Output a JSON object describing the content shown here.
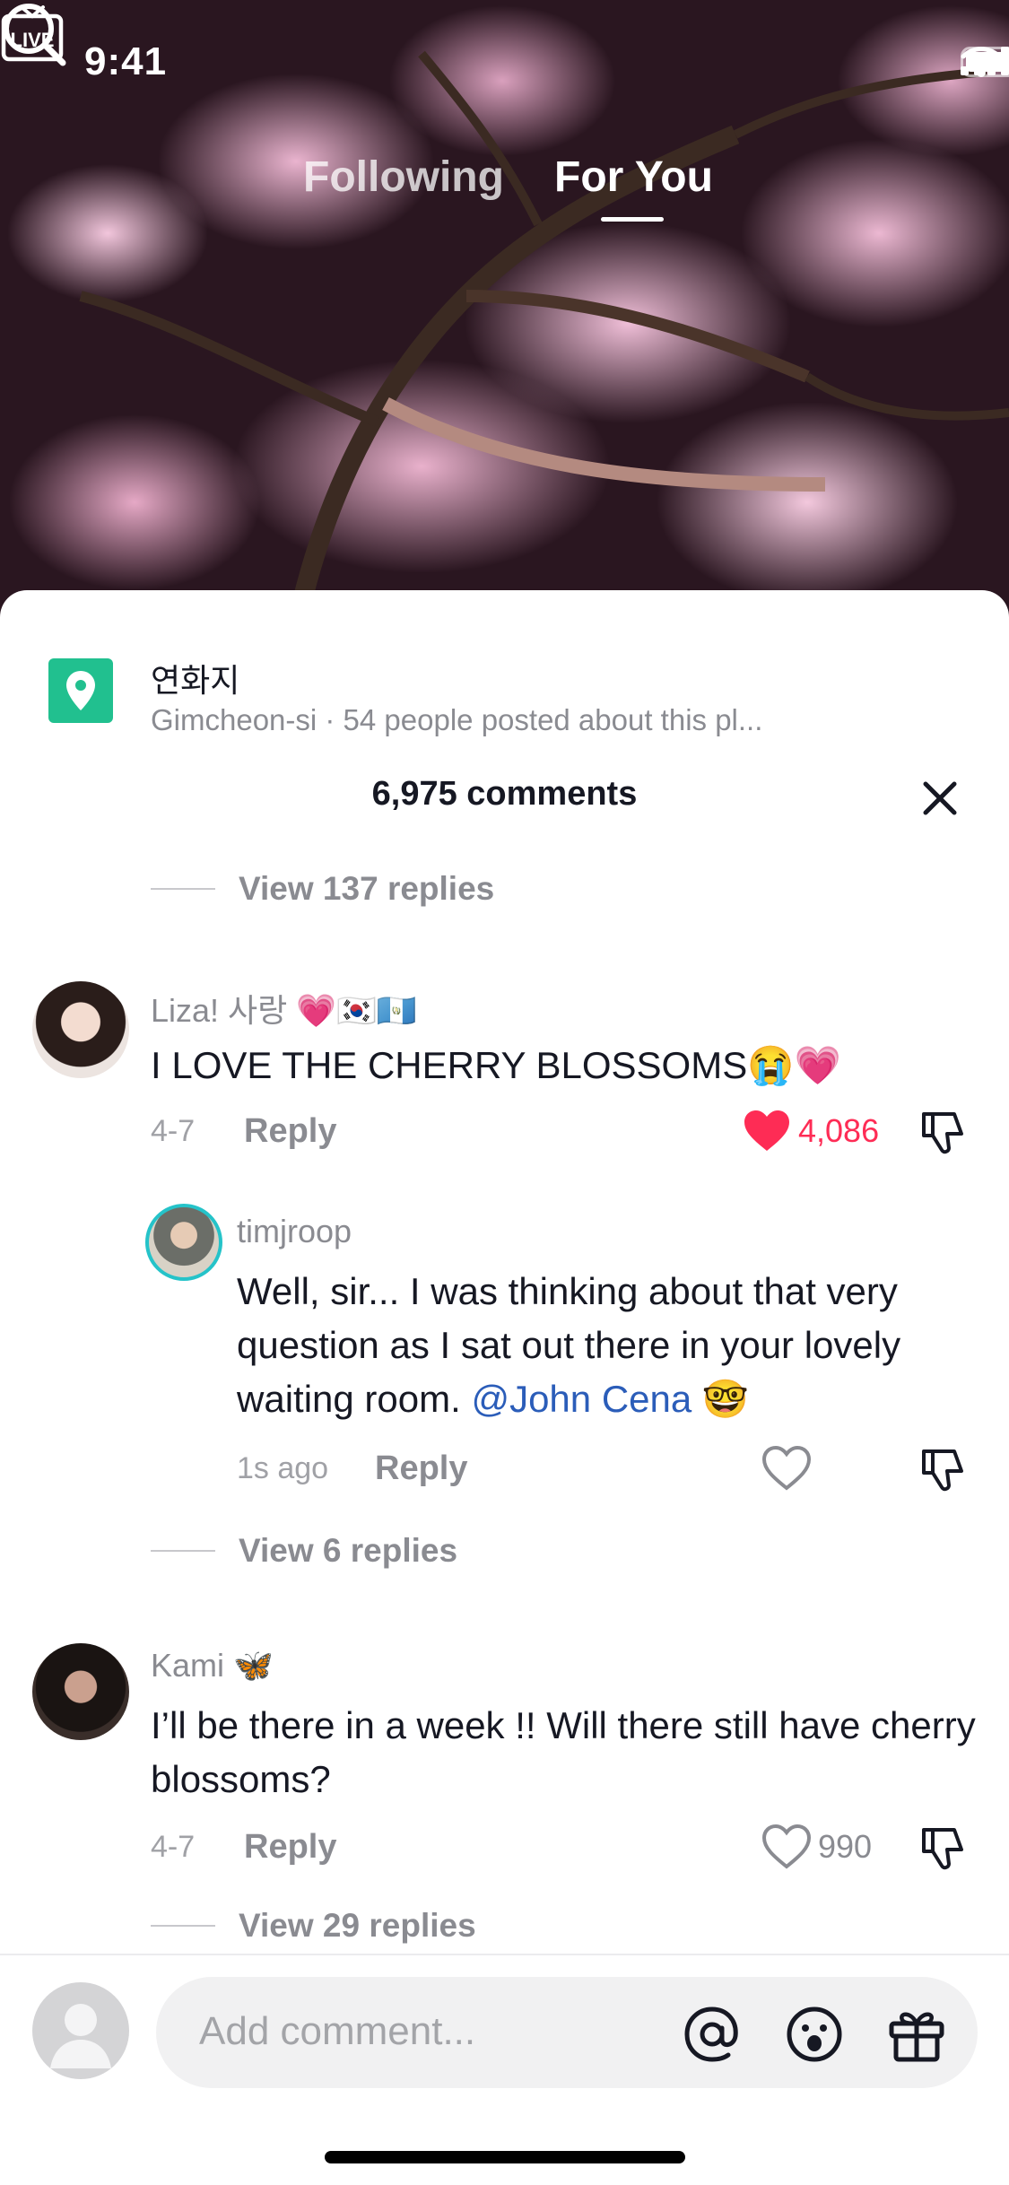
{
  "status_bar": {
    "time": "9:41"
  },
  "nav": {
    "following": "Following",
    "for_you": "For You"
  },
  "location": {
    "name": "연화지",
    "subtitle": "Gimcheon-si · 54 people posted about this pl..."
  },
  "comments_header": "6,975 comments",
  "view_replies_top": "View 137 replies",
  "comments": [
    {
      "username": "Liza! 사랑 💗🇰🇷🇬🇹",
      "text": "I LOVE THE CHERRY BLOSSOMS😭💗",
      "date": "4-7",
      "reply_label": "Reply",
      "likes": "4,086",
      "liked": true
    },
    {
      "username": "timjroop",
      "text_before": "Well, sir... I was thinking about that very question as I sat out there in your lovely waiting room.",
      "mention": "@John Cena",
      "text_after": "🤓",
      "date": "1s ago",
      "reply_label": "Reply"
    },
    {
      "username": "Kami 🦋",
      "text": "I’ll be there in a week !! Will there still have cherry blossoms?",
      "date": "4-7",
      "reply_label": "Reply",
      "likes": "990",
      "liked": false
    }
  ],
  "view_replies_mid": "View 6 replies",
  "view_replies_bottom": "View 29 replies",
  "input": {
    "placeholder": "Add comment..."
  },
  "colors": {
    "accent_like": "#fe2c55",
    "location_green": "#21c08f",
    "mention_blue": "#2b5db9"
  },
  "icons": [
    "live-icon",
    "search-icon",
    "location-pin-icon",
    "close-icon",
    "heart-icon",
    "dislike-icon",
    "at-icon",
    "emoji-icon",
    "gift-icon"
  ]
}
